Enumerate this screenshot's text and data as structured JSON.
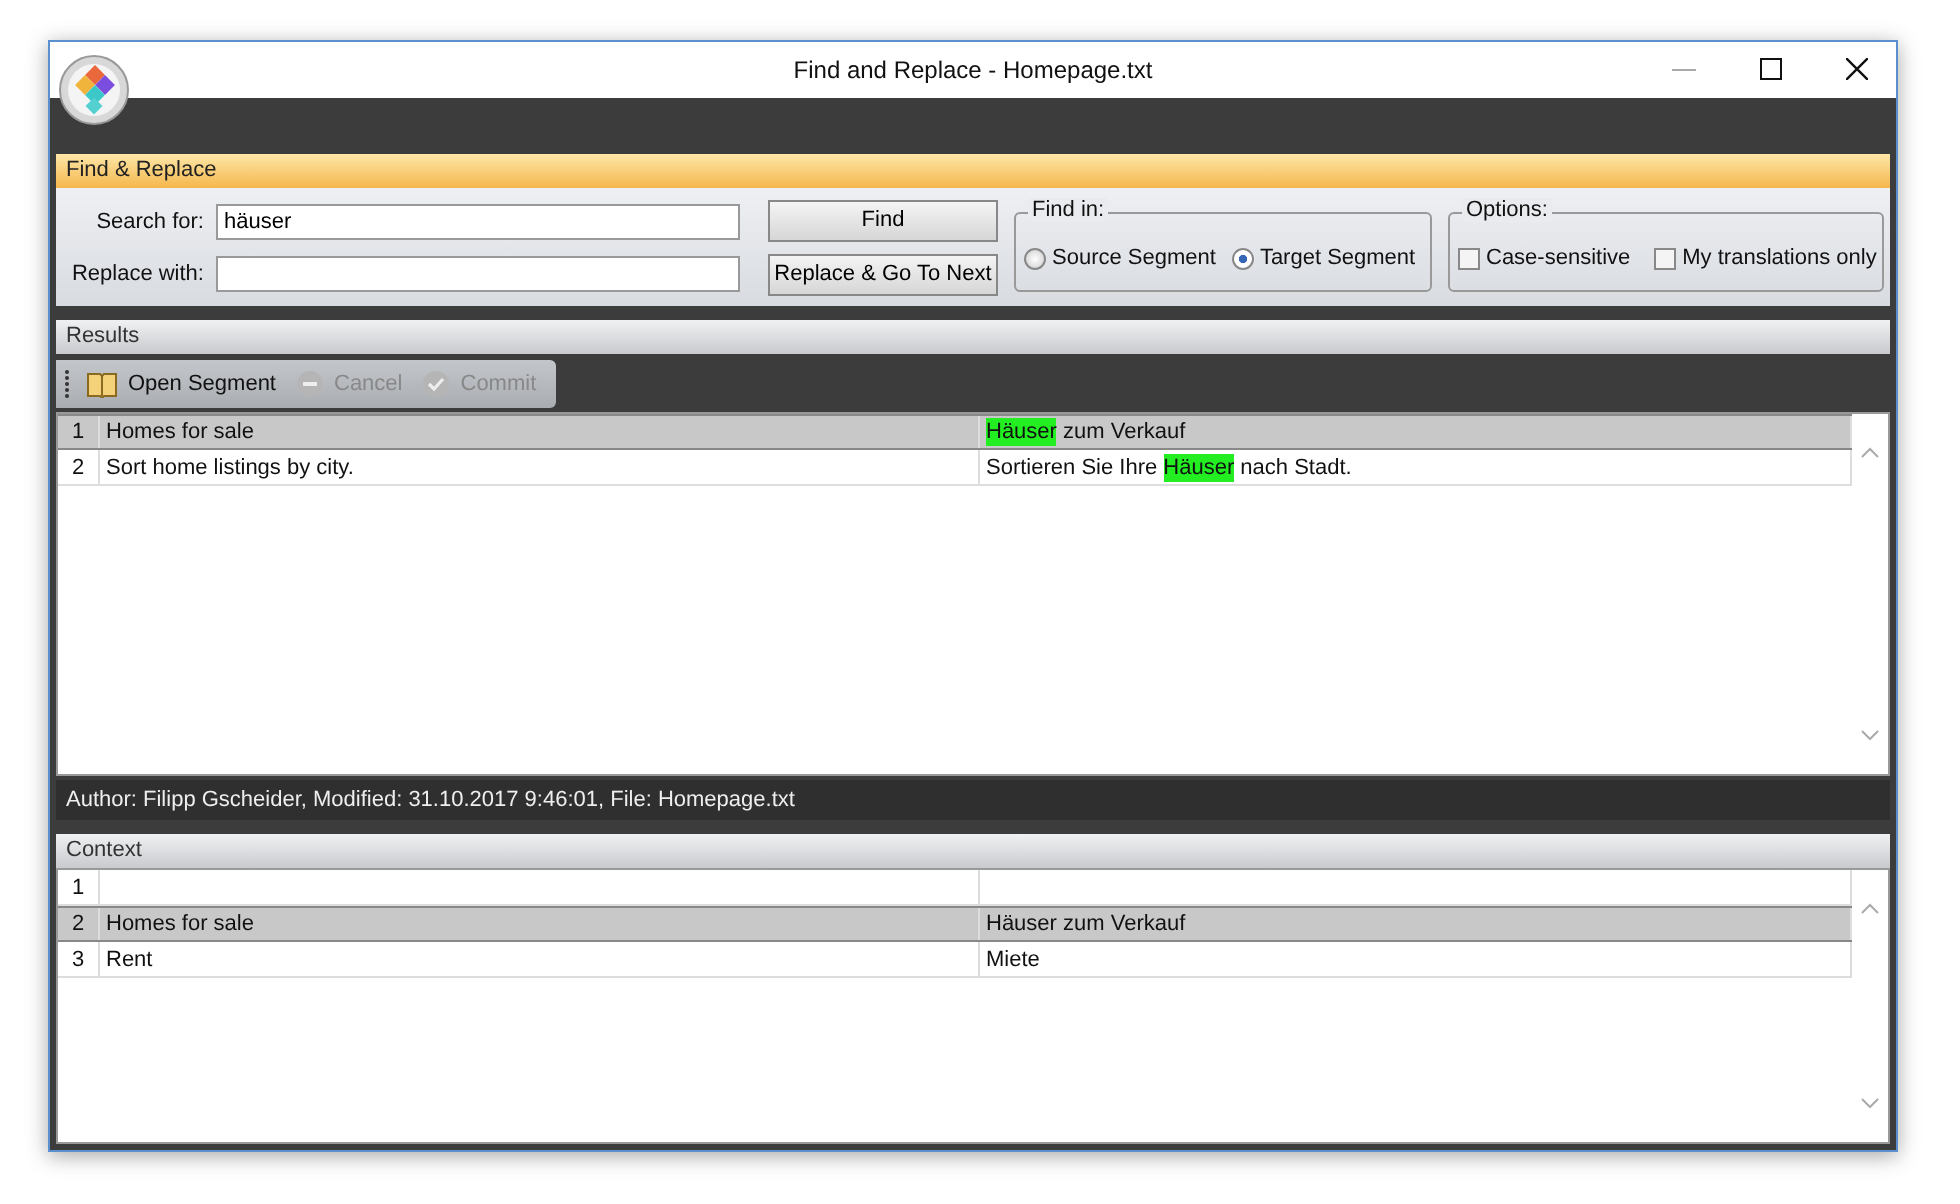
{
  "window": {
    "title": "Find and Replace - Homepage.txt"
  },
  "find_replace": {
    "header": "Find & Replace",
    "search_label": "Search for:",
    "search_value": "häuser",
    "replace_label": "Replace with:",
    "buttons": [
      "Find",
      "Replace & Go To Next"
    ],
    "find_in": {
      "legend": "Find in:",
      "options": [
        {
          "label": "Source Segment",
          "selected": false
        },
        {
          "label": "Target Segment",
          "selected": true
        }
      ]
    },
    "options": {
      "legend": "Options:",
      "items": [
        {
          "label": "Case-sensitive",
          "checked": false
        },
        {
          "label": "My translations only",
          "checked": false
        }
      ]
    }
  },
  "results": {
    "header": "Results",
    "toolbar": [
      {
        "label": "Open Segment",
        "disabled": false
      },
      {
        "label": "Cancel",
        "disabled": true
      },
      {
        "label": "Commit",
        "disabled": true
      }
    ],
    "rows": [
      {
        "number": "1",
        "source": "Homes for sale",
        "target": [
          {
            "text": "Häuser",
            "highlight": true
          },
          {
            "text": " zum Verkauf",
            "highlight": false
          }
        ],
        "selected": true
      },
      {
        "number": "2",
        "source": "Sort home listings by city.",
        "target": [
          {
            "text": "Sortieren Sie Ihre ",
            "highlight": false
          },
          {
            "text": "Häuser",
            "highlight": true
          },
          {
            "text": " nach Stadt.",
            "highlight": false
          }
        ],
        "selected": false
      }
    ],
    "status": "Author: Filipp Gscheider, Modified: 31.10.2017 9:46:01, File: Homepage.txt"
  },
  "context": {
    "header": "Context",
    "rows": [
      {
        "number": "1",
        "selected": false
      },
      {
        "number": "2",
        "source": "Homes for sale",
        "target": "Häuser zum Verkauf",
        "selected": true
      },
      {
        "number": "3",
        "source": "Rent",
        "target": "Miete",
        "selected": false
      }
    ]
  }
}
